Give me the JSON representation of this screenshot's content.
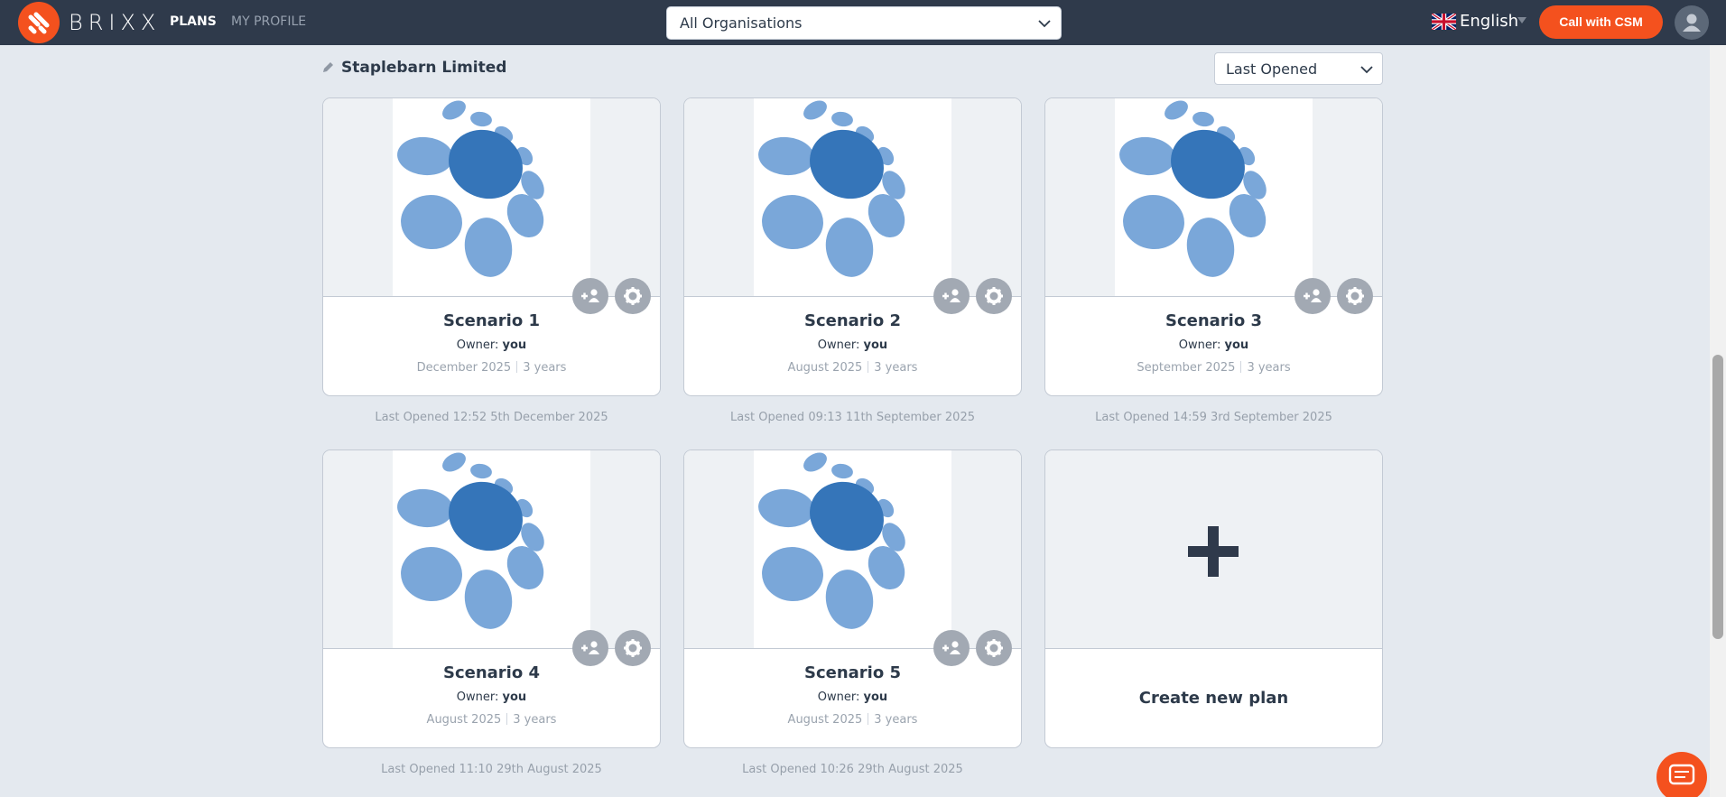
{
  "header": {
    "brand": "BRIXX",
    "nav": {
      "plans": "PLANS",
      "my_profile": "MY PROFILE"
    },
    "org_select": {
      "value": "All Organisations"
    },
    "language": "English",
    "call_button": "Call with CSM"
  },
  "organisation": {
    "name": "Staplebarn Limited",
    "sort_select": {
      "value": "Last Opened"
    }
  },
  "plans": [
    {
      "title": "Scenario 1",
      "owner_label": "Owner:",
      "owner": "you",
      "start": "December 2025",
      "duration": "3 years",
      "last_opened": "Last Opened 12:52 5th December 2025"
    },
    {
      "title": "Scenario 2",
      "owner_label": "Owner:",
      "owner": "you",
      "start": "August 2025",
      "duration": "3 years",
      "last_opened": "Last Opened 09:13 11th September 2025"
    },
    {
      "title": "Scenario 3",
      "owner_label": "Owner:",
      "owner": "you",
      "start": "September 2025",
      "duration": "3 years",
      "last_opened": "Last Opened 14:59 3rd September 2025"
    },
    {
      "title": "Scenario 4",
      "owner_label": "Owner:",
      "owner": "you",
      "start": "August 2025",
      "duration": "3 years",
      "last_opened": "Last Opened 11:10 29th August 2025"
    },
    {
      "title": "Scenario 5",
      "owner_label": "Owner:",
      "owner": "you",
      "start": "August 2025",
      "duration": "3 years",
      "last_opened": "Last Opened 10:26 29th August 2025"
    }
  ],
  "create_plan": {
    "label": "Create new plan"
  },
  "colors": {
    "nav_bg": "#2f3a4b",
    "accent": "#f4511e",
    "page_bg": "#e4e9ef",
    "logo_dark_blue": "#3575b9",
    "logo_light_blue": "#7aa7d9",
    "icon_button_grey": "#a2a9b3"
  },
  "icons": {
    "brand_logo": "brixx-logo-icon",
    "org_dropdown": "chevron-down-icon",
    "language_flag": "uk-flag-icon",
    "language_caret": "caret-down-icon",
    "user_avatar": "user-icon",
    "edit": "pencil-icon",
    "share": "add-user-icon",
    "settings": "gear-icon",
    "create": "plus-icon",
    "chat": "chat-icon"
  }
}
